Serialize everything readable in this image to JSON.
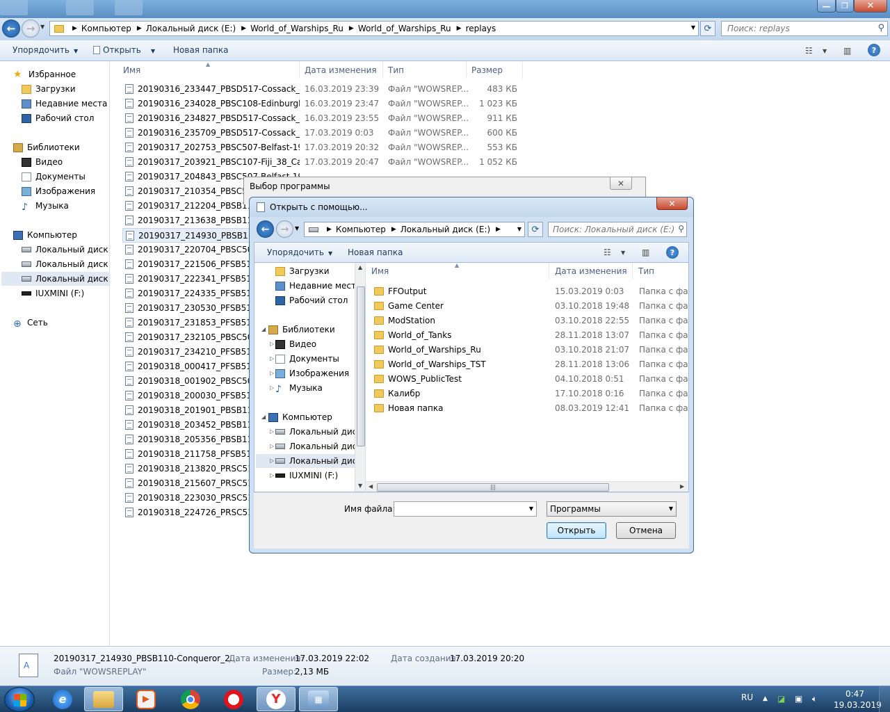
{
  "explorer": {
    "address": {
      "crumbs": [
        "Компьютер",
        "Локальный диск (E:)",
        "World_of_Warships_Ru",
        "World_of_Warships_Ru",
        "replays"
      ],
      "search_placeholder": "Поиск: replays"
    },
    "toolbar": {
      "organize": "Упорядочить",
      "open": "Открыть",
      "new_folder": "Новая папка"
    },
    "nav": {
      "favorites": "Избранное",
      "downloads": "Загрузки",
      "recent": "Недавние места",
      "desktop": "Рабочий стол",
      "libraries": "Библиотеки",
      "video": "Видео",
      "documents": "Документы",
      "images": "Изображения",
      "music": "Музыка",
      "computer": "Компьютер",
      "disk_c": "Локальный диск (C",
      "disk_d": "Локальный диск (D",
      "disk_e": "Локальный диск (E:",
      "iuxmini": "IUXMINI (F:)",
      "network": "Сеть"
    },
    "columns": {
      "name": "Имя",
      "date": "Дата изменения",
      "type": "Тип",
      "size": "Размер"
    },
    "files": [
      {
        "name": "20190316_233447_PBSD517-Cossack_15_...",
        "date": "16.03.2019 23:39",
        "type": "Файл \"WOWSREP...",
        "size": "483 КБ"
      },
      {
        "name": "20190316_234028_PBSC108-Edinburgh_42...",
        "date": "16.03.2019 23:47",
        "type": "Файл \"WOWSREP...",
        "size": "1 023 КБ"
      },
      {
        "name": "20190316_234827_PBSD517-Cossack_22_ti...",
        "date": "16.03.2019 23:55",
        "type": "Файл \"WOWSREP...",
        "size": "911 КБ"
      },
      {
        "name": "20190316_235709_PBSD517-Cossack_44_P...",
        "date": "17.03.2019 0:03",
        "type": "Файл \"WOWSREP...",
        "size": "600 КБ"
      },
      {
        "name": "20190317_202753_PBSC507-Belfast-1959_...",
        "date": "17.03.2019 20:32",
        "type": "Файл \"WOWSREP...",
        "size": "553 КБ"
      },
      {
        "name": "20190317_203921_PBSC107-Fiji_38_Canada",
        "date": "17.03.2019 20:47",
        "type": "Файл \"WOWSREP...",
        "size": "1 052 КБ"
      },
      {
        "name": "20190317_204843_PBSC507-Belfast-1959_",
        "date": "",
        "type": "",
        "size": ""
      },
      {
        "name": "20190317_210354_PBSC507-B",
        "date": "",
        "type": "",
        "size": ""
      },
      {
        "name": "20190317_212204_PBSB110-C",
        "date": "",
        "type": "",
        "size": ""
      },
      {
        "name": "20190317_213638_PBSB110-C",
        "date": "",
        "type": "",
        "size": ""
      },
      {
        "name": "20190317_214930_PBSB110-C",
        "date": "",
        "type": "",
        "size": ""
      },
      {
        "name": "20190317_220704_PBSC507-B",
        "date": "",
        "type": "",
        "size": ""
      },
      {
        "name": "20190317_221506_PFSB518-Je",
        "date": "",
        "type": "",
        "size": ""
      },
      {
        "name": "20190317_222341_PFSB518-Je",
        "date": "",
        "type": "",
        "size": ""
      },
      {
        "name": "20190317_224335_PFSB518-Je",
        "date": "",
        "type": "",
        "size": ""
      },
      {
        "name": "20190317_230530_PFSB518-Je",
        "date": "",
        "type": "",
        "size": ""
      },
      {
        "name": "20190317_231853_PFSB518-Je",
        "date": "",
        "type": "",
        "size": ""
      },
      {
        "name": "20190317_232105_PBSC507-B",
        "date": "",
        "type": "",
        "size": ""
      },
      {
        "name": "20190317_234210_PFSB518-Je",
        "date": "",
        "type": "",
        "size": ""
      },
      {
        "name": "20190318_000417_PFSB518-Je",
        "date": "",
        "type": "",
        "size": ""
      },
      {
        "name": "20190318_001902_PBSC507-B",
        "date": "",
        "type": "",
        "size": ""
      },
      {
        "name": "20190318_200030_PFSB518-Je",
        "date": "",
        "type": "",
        "size": ""
      },
      {
        "name": "20190318_201901_PBSB110-C",
        "date": "",
        "type": "",
        "size": ""
      },
      {
        "name": "20190318_203452_PBSB110-C",
        "date": "",
        "type": "",
        "size": ""
      },
      {
        "name": "20190318_205356_PBSB110-C",
        "date": "",
        "type": "",
        "size": ""
      },
      {
        "name": "20190318_211758_PFSB518-Je",
        "date": "",
        "type": "",
        "size": ""
      },
      {
        "name": "20190318_213820_PRSC510-S",
        "date": "",
        "type": "",
        "size": ""
      },
      {
        "name": "20190318_215607_PRSC510-S",
        "date": "",
        "type": "",
        "size": ""
      },
      {
        "name": "20190318_223030_PRSC510-S",
        "date": "",
        "type": "",
        "size": ""
      },
      {
        "name": "20190318_224726_PRSC510-Sta",
        "date": "",
        "type": "",
        "size": ""
      }
    ],
    "details": {
      "name": "20190317_214930_PBSB110-Conqueror_2...",
      "type": "Файл \"WOWSREPLAY\"",
      "modified_label": "Дата изменения:",
      "modified": "17.03.2019 22:02",
      "size_label": "Размер:",
      "size": "2,13 МБ",
      "created_label": "Дата создания:",
      "created": "17.03.2019 20:20"
    }
  },
  "dialog_back": {
    "title": "Выбор программы"
  },
  "dialog": {
    "title": "Открыть с помощью...",
    "address": {
      "crumbs": [
        "Компьютер",
        "Локальный диск (E:)"
      ],
      "search_placeholder": "Поиск: Локальный диск (E:)"
    },
    "toolbar": {
      "organize": "Упорядочить",
      "new_folder": "Новая папка"
    },
    "nav": {
      "downloads": "Загрузки",
      "recent": "Недавние места",
      "desktop": "Рабочий стол",
      "libraries": "Библиотеки",
      "video": "Видео",
      "documents": "Документы",
      "images": "Изображения",
      "music": "Музыка",
      "computer": "Компьютер",
      "disk_c": "Локальный диск",
      "disk_d": "Локальный диск",
      "disk_e": "Локальный диск",
      "iuxmini": "IUXMINI (F:)"
    },
    "columns": {
      "name": "Имя",
      "date": "Дата изменения",
      "type": "Тип"
    },
    "folders": [
      {
        "name": "FFOutput",
        "date": "15.03.2019 0:03",
        "type": "Папка с фай"
      },
      {
        "name": "Game Center",
        "date": "03.10.2018 19:48",
        "type": "Папка с фай"
      },
      {
        "name": "ModStation",
        "date": "03.10.2018 22:55",
        "type": "Папка с фай"
      },
      {
        "name": "World_of_Tanks",
        "date": "28.11.2018 13:07",
        "type": "Папка с фай"
      },
      {
        "name": "World_of_Warships_Ru",
        "date": "03.10.2018 21:07",
        "type": "Папка с фай"
      },
      {
        "name": "World_of_Warships_TST",
        "date": "28.11.2018 13:06",
        "type": "Папка с фай"
      },
      {
        "name": "WOWS_PublicTest",
        "date": "04.10.2018 0:51",
        "type": "Папка с фай"
      },
      {
        "name": "Калибр",
        "date": "17.10.2018 0:16",
        "type": "Папка с фай"
      },
      {
        "name": "Новая папка",
        "date": "08.03.2019 12:41",
        "type": "Папка с фай"
      }
    ],
    "filename_label": "Имя файла:",
    "filename_value": "",
    "filetype_value": "Программы",
    "open_label": "Открыть",
    "cancel_label": "Отмена"
  },
  "taskbar": {
    "lang": "RU",
    "time": "0:47",
    "date": "19.03.2019",
    "apps": [
      "file-manager",
      "media-player",
      "chrome",
      "opera",
      "yandex-browser",
      "control-panel"
    ]
  },
  "colors": {
    "accent": "#1e5ea8",
    "selection": "#e5eef8",
    "taskbar": "#1b3e63",
    "close": "#c64b2f"
  }
}
